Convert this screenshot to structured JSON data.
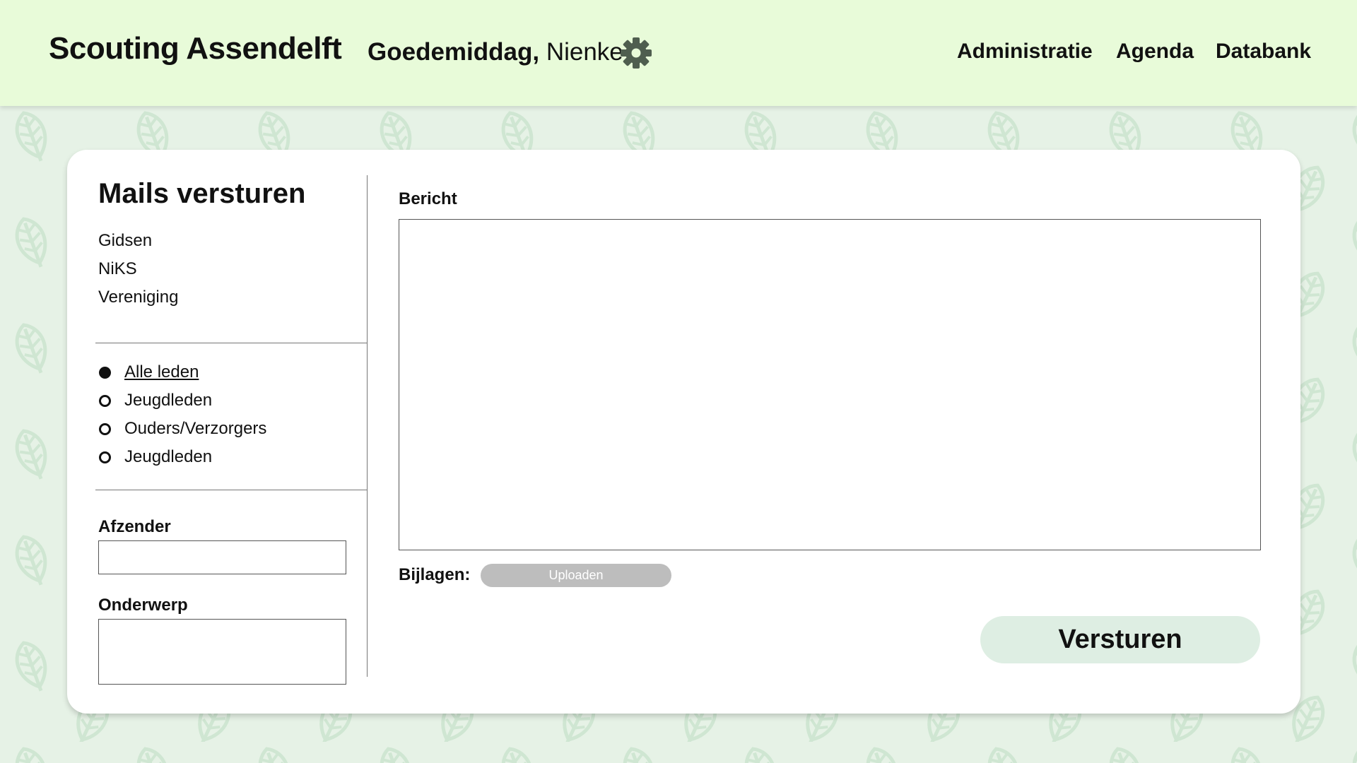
{
  "header": {
    "brand": "Scouting Assendelft",
    "greeting_prefix": "Goedemiddag,",
    "user_name": "Nienke",
    "settings_icon": "gear-icon",
    "nav": [
      "Administratie",
      "Agenda",
      "Databank"
    ]
  },
  "sidebar": {
    "title": "Mails versturen",
    "groups": [
      "Gidsen",
      "NiKS",
      "Vereniging"
    ],
    "recipients": [
      {
        "label": "Alle leden",
        "selected": true
      },
      {
        "label": "Jeugdleden",
        "selected": false
      },
      {
        "label": "Ouders/Verzorgers",
        "selected": false
      },
      {
        "label": "Jeugdleden",
        "selected": false
      }
    ],
    "sender_label": "Afzender",
    "sender_value": "",
    "subject_label": "Onderwerp",
    "subject_value": ""
  },
  "message": {
    "label": "Bericht",
    "value": "",
    "attachments_label": "Bijlagen:",
    "upload_label": "Uploaden",
    "send_label": "Versturen"
  },
  "colors": {
    "header_bg": "#e8fbd9",
    "page_bg": "#e6f2e6",
    "leaf": "#cfe6d2",
    "send_button_bg": "#deeee3",
    "upload_button_bg": "#bdbdbd"
  }
}
